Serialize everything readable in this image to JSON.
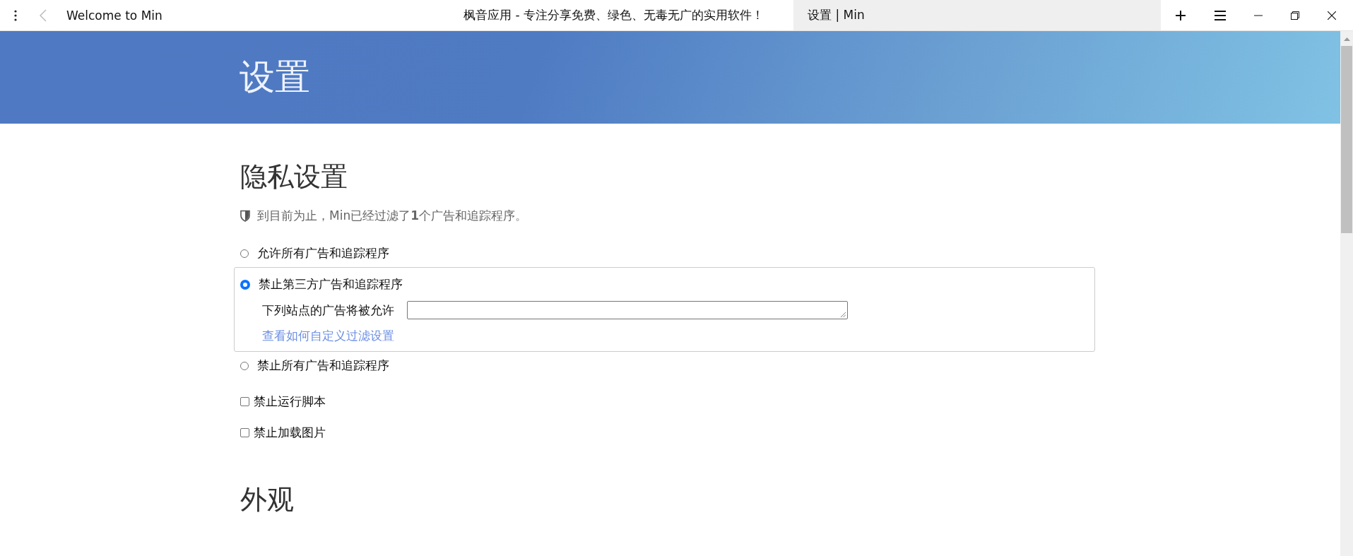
{
  "tabs": [
    {
      "title": "Welcome to Min",
      "selected": false
    },
    {
      "title": "枫音应用 - 专注分享免费、绿色、无毒无广的实用软件！",
      "selected": false
    },
    {
      "title": "设置 | Min",
      "selected": true
    }
  ],
  "header": {
    "title": "设置"
  },
  "privacy": {
    "heading": "隐私设置",
    "blocked_stat": "到目前为止，Min已经过滤了**1**个广告和追踪程序。",
    "options": [
      {
        "label": "允许所有广告和追踪程序",
        "selected": false
      },
      {
        "label": "禁止第三方广告和追踪程序",
        "selected": true,
        "whitelist_label": "下列站点的广告将被允许",
        "link": "查看如何自定义过滤设置"
      },
      {
        "label": "禁止所有广告和追踪程序",
        "selected": false
      }
    ],
    "checkboxes": [
      {
        "label": "禁止运行脚本",
        "checked": false
      },
      {
        "label": "禁止加载图片",
        "checked": false
      }
    ]
  },
  "appearance": {
    "heading": "外观"
  }
}
